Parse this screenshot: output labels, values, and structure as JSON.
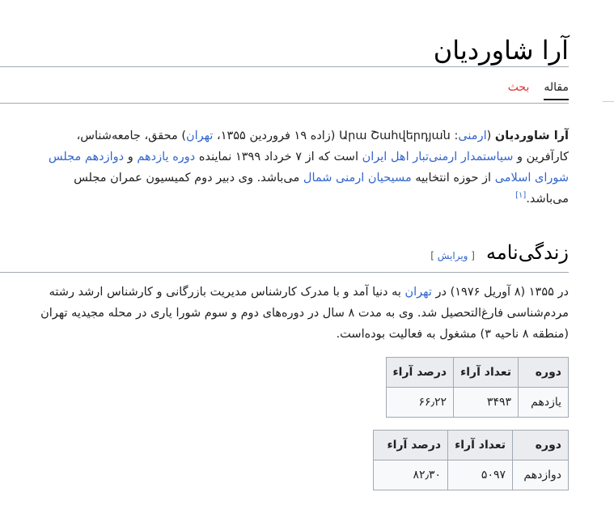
{
  "article": {
    "title": "آرا شاوردیان"
  },
  "tabs": {
    "article": "مقاله",
    "talk": "بحث"
  },
  "lead": {
    "name_bold": "آرا شاوردیان",
    "lang_link": "ارمنی",
    "native_name": ": Արա Շահվերդյան",
    "birth_prefix": " (زاده ۱۹ فروردین ۱۳۵۵، ",
    "birth_city": "تهران",
    "after_city": ") محقق، جامعه‌شناس، کارآفرین و ",
    "politician_link": "سیاستمدار",
    "link_armenians": "ارمنی‌تبار اهل ایران",
    "rep_text": " است که از ۷ خرداد ۱۳۹۹ نماینده ",
    "term_link": "دوره یازدهم",
    "and": " و ",
    "parliament_link": "دوازدهم مجلس شورای اسلامی",
    "district_text": " از حوزه انتخابیه ",
    "district_link": "مسیحیان ارمنی شمال",
    "ending": " می‌باشد. وی دبیر دوم کمیسیون عمران مجلس می‌باشد.",
    "ref": "[۱]"
  },
  "biography": {
    "heading": "زندگی‌نامه",
    "edit_open": "[ ",
    "edit_label": "ویرایش",
    "edit_close": " ]",
    "text_1": "در ۱۳۵۵ (۸ آوریل ۱۹۷۶) در ",
    "city_link": "تهران",
    "text_2": " به دنیا آمد و با مدرک کارشناس مدیریت بازرگانی و کارشناس ارشد رشته مردم‌شناسی فارغ‌التحصیل شد. وی به مدت ۸ سال در دوره‌های دوم و سوم شورا یاری در محله مجیدیه تهران (منطقه ۸ ناحیه ۳) مشغول به فعالیت بوده‌است."
  },
  "tables": [
    {
      "headers": [
        "دوره",
        "تعداد آراء",
        "درصد آراء"
      ],
      "row": [
        "یازدهم",
        "۳۴۹۳",
        "۶۶٫۲۲"
      ]
    },
    {
      "headers": [
        "دوره",
        "تعداد آراء",
        "درصد آراء"
      ],
      "row": [
        "دوازدهم",
        "۵۰۹۷",
        "۸۲٫۳۰"
      ]
    }
  ]
}
